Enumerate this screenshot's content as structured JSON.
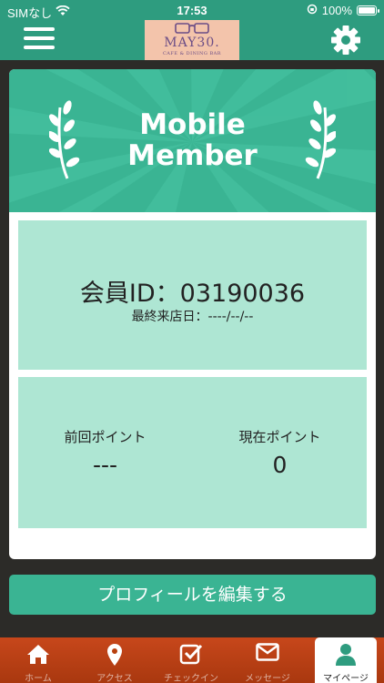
{
  "status_bar": {
    "carrier": "SIMなし",
    "time": "17:53",
    "battery": "100%"
  },
  "header": {
    "logo_title": "MAY30.",
    "logo_subtitle": "CAFE & DINING BAR"
  },
  "banner": {
    "line1": "Mobile",
    "line2": "Member"
  },
  "member": {
    "id_text": "会員ID：03190036",
    "last_visit_text": "最終来店日：----/--/--"
  },
  "points": {
    "previous_label": "前回ポイント",
    "previous_value": "---",
    "current_label": "現在ポイント",
    "current_value": "0"
  },
  "edit_profile_label": "プロフィールを編集する",
  "tabs": [
    {
      "label": "ホーム",
      "icon": "home-icon"
    },
    {
      "label": "アクセス",
      "icon": "map-pin-icon"
    },
    {
      "label": "チェックイン",
      "icon": "checkin-icon"
    },
    {
      "label": "メッセージ",
      "icon": "envelope-icon"
    },
    {
      "label": "マイページ",
      "icon": "user-icon"
    }
  ],
  "colors": {
    "primary": "#2e9c7f",
    "accent_green": "#3ab493",
    "panel_mint": "#aee6d3",
    "logo_bg": "#f3c4ab",
    "tab_bar": "#c7471b"
  }
}
